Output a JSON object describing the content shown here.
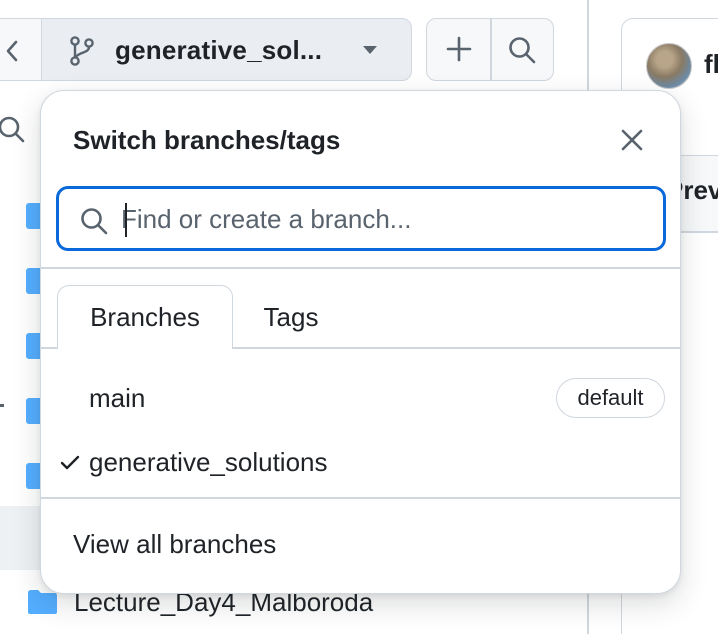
{
  "header": {
    "current_branch": "generative_sol...",
    "user_name": "fl"
  },
  "file_tree": {
    "last_visible_folder": "Lecture_Day4_Malboroda"
  },
  "right_pane": {
    "tab_label": "Prev"
  },
  "popover": {
    "title": "Switch branches/tags",
    "search": {
      "placeholder": "Find or create a branch...",
      "value": ""
    },
    "tabs": [
      {
        "label": "Branches",
        "active": true
      },
      {
        "label": "Tags",
        "active": false
      }
    ],
    "branches": [
      {
        "name": "main",
        "badge": "default",
        "selected": false
      },
      {
        "name": "generative_solutions",
        "badge": "",
        "selected": true
      }
    ],
    "footer_link": "View all branches"
  },
  "icons": {
    "branch": "git-branch-icon",
    "caret": "triangle-down-icon",
    "plus": "plus-icon",
    "search": "search-icon",
    "close": "x-icon",
    "check": "check-icon",
    "folder": "folder-icon"
  },
  "colors": {
    "accent": "#0969da",
    "folder": "#54aeff",
    "border": "#d0d7de",
    "text": "#1f2328"
  }
}
